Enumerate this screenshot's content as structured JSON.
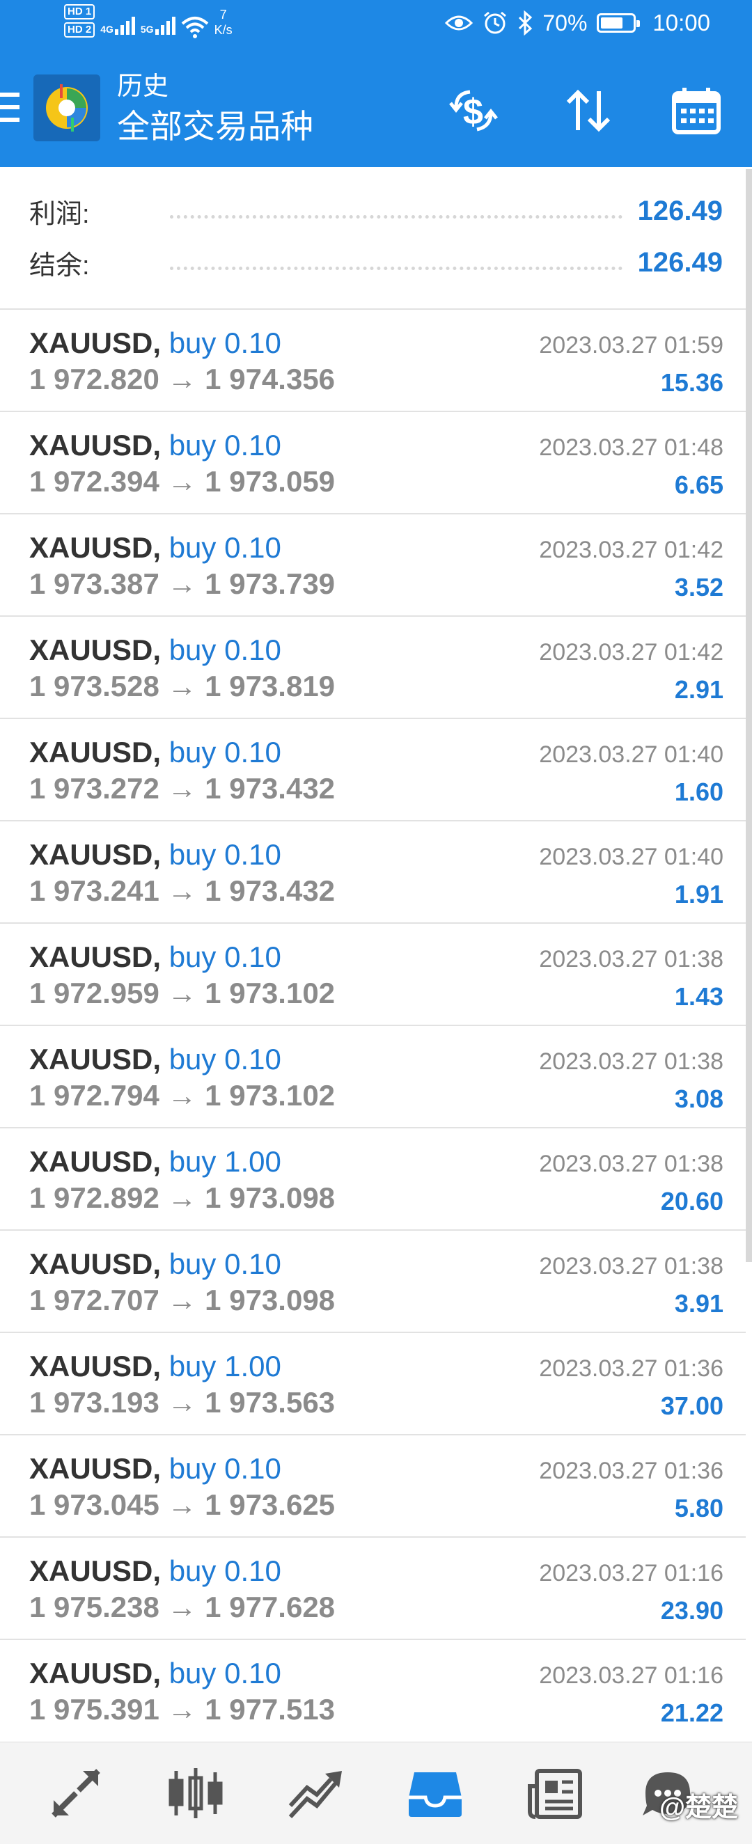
{
  "status_bar": {
    "hd1": "HD 1",
    "hd2": "HD 2",
    "sig1": "4G",
    "sig2": "5G",
    "speed_value": "7",
    "speed_unit": "K/s",
    "battery": "70%",
    "time": "10:00",
    "battery_level": 0.7,
    "icons": [
      "eye-icon",
      "alarm-icon",
      "bluetooth-icon"
    ]
  },
  "appbar": {
    "subtitle": "历史",
    "title": "全部交易品种",
    "icons": [
      "menu-icon",
      "app-logo",
      "dollar-refresh-icon",
      "sort-icon",
      "calendar-icon"
    ]
  },
  "summary": {
    "profit_label": "利润:",
    "profit_value": "126.49",
    "balance_label": "结余:",
    "balance_value": "126.49"
  },
  "trades": [
    {
      "symbol": "XAUUSD,",
      "side": "buy 0.10",
      "prices": "1 972.820 → 1 974.356",
      "date": "2023.03.27 01:59",
      "profit": "15.36"
    },
    {
      "symbol": "XAUUSD,",
      "side": "buy 0.10",
      "prices": "1 972.394 → 1 973.059",
      "date": "2023.03.27 01:48",
      "profit": "6.65"
    },
    {
      "symbol": "XAUUSD,",
      "side": "buy 0.10",
      "prices": "1 973.387 → 1 973.739",
      "date": "2023.03.27 01:42",
      "profit": "3.52"
    },
    {
      "symbol": "XAUUSD,",
      "side": "buy 0.10",
      "prices": "1 973.528 → 1 973.819",
      "date": "2023.03.27 01:42",
      "profit": "2.91"
    },
    {
      "symbol": "XAUUSD,",
      "side": "buy 0.10",
      "prices": "1 973.272 → 1 973.432",
      "date": "2023.03.27 01:40",
      "profit": "1.60"
    },
    {
      "symbol": "XAUUSD,",
      "side": "buy 0.10",
      "prices": "1 973.241 → 1 973.432",
      "date": "2023.03.27 01:40",
      "profit": "1.91"
    },
    {
      "symbol": "XAUUSD,",
      "side": "buy 0.10",
      "prices": "1 972.959 → 1 973.102",
      "date": "2023.03.27 01:38",
      "profit": "1.43"
    },
    {
      "symbol": "XAUUSD,",
      "side": "buy 0.10",
      "prices": "1 972.794 → 1 973.102",
      "date": "2023.03.27 01:38",
      "profit": "3.08"
    },
    {
      "symbol": "XAUUSD,",
      "side": "buy 1.00",
      "prices": "1 972.892 → 1 973.098",
      "date": "2023.03.27 01:38",
      "profit": "20.60"
    },
    {
      "symbol": "XAUUSD,",
      "side": "buy 0.10",
      "prices": "1 972.707 → 1 973.098",
      "date": "2023.03.27 01:38",
      "profit": "3.91"
    },
    {
      "symbol": "XAUUSD,",
      "side": "buy 1.00",
      "prices": "1 973.193 → 1 973.563",
      "date": "2023.03.27 01:36",
      "profit": "37.00"
    },
    {
      "symbol": "XAUUSD,",
      "side": "buy 0.10",
      "prices": "1 973.045 → 1 973.625",
      "date": "2023.03.27 01:36",
      "profit": "5.80"
    },
    {
      "symbol": "XAUUSD,",
      "side": "buy 0.10",
      "prices": "1 975.238 → 1 977.628",
      "date": "2023.03.27 01:16",
      "profit": "23.90"
    },
    {
      "symbol": "XAUUSD,",
      "side": "buy 0.10",
      "prices": "1 975.391 → 1 977.513",
      "date": "2023.03.27 01:16",
      "profit": "21.22"
    }
  ],
  "bottom_nav": {
    "items": [
      "quotes-icon",
      "chart-candles-icon",
      "trade-icon",
      "history-inbox-icon",
      "news-icon",
      "messages-icon"
    ],
    "active": "history-inbox-icon",
    "watermark": "@楚楚"
  },
  "colors": {
    "accent": "#1e88e5",
    "value_blue": "#1e7ad4",
    "text_dark": "#333333",
    "text_gray": "#8b8b8b"
  }
}
